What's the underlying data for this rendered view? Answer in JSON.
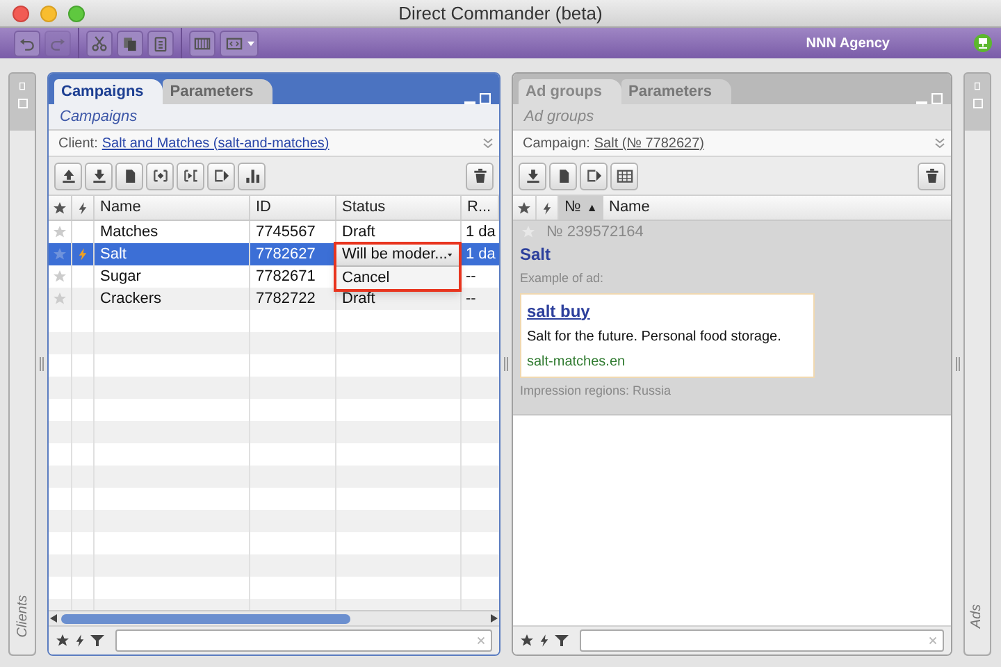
{
  "window": {
    "title": "Direct Commander (beta)"
  },
  "toolbar": {
    "buttons": [
      {
        "kind": "undo",
        "disabled": false
      },
      {
        "kind": "redo",
        "disabled": true
      },
      {
        "kind": "cut",
        "disabled": false
      },
      {
        "kind": "copy",
        "disabled": false
      },
      {
        "kind": "paste",
        "disabled": false
      },
      {
        "kind": "columns",
        "disabled": false
      },
      {
        "kind": "layout",
        "disabled": false
      }
    ],
    "account": "NNN Agency"
  },
  "left_strip": {
    "label": "Clients"
  },
  "campaigns_panel": {
    "tabs": [
      {
        "label": "Campaigns",
        "selected": true
      },
      {
        "label": "Parameters",
        "selected": false
      }
    ],
    "subtitle": "Campaigns",
    "filter_label": "Client:",
    "filter_value": "Salt and Matches (salt-and-matches)",
    "toolbar": [
      {
        "kind": "upload"
      },
      {
        "kind": "download"
      },
      {
        "kind": "document"
      },
      {
        "kind": "swap"
      },
      {
        "kind": "import"
      },
      {
        "kind": "export"
      },
      {
        "kind": "chart"
      }
    ],
    "columns": [
      "Name",
      "ID",
      "Status",
      "R..."
    ],
    "rows": [
      {
        "name": "Matches",
        "id": "7745567",
        "status": "Draft",
        "column_4": "1 da",
        "selected": false,
        "flagged": false
      },
      {
        "name": "Salt",
        "id": "7782627",
        "status_editor": {
          "value": "Will be moder...",
          "options": [
            "Cancel"
          ]
        },
        "column_4": "1 da",
        "selected": true,
        "flagged": true
      },
      {
        "name": "Sugar",
        "id": "7782671",
        "column_4": "--",
        "selected": false,
        "flagged": false
      },
      {
        "name": "Crackers",
        "id": "7782722",
        "status": "Draft",
        "column_4": "--",
        "selected": false,
        "flagged": false
      }
    ]
  },
  "ad_groups_panel": {
    "tabs": [
      {
        "label": "Ad groups",
        "selected": true
      },
      {
        "label": "Parameters",
        "selected": false
      }
    ],
    "subtitle": "Ad groups",
    "filter_label": "Campaign:",
    "filter_value": "Salt (№ 7782627)",
    "toolbar": [
      {
        "kind": "download"
      },
      {
        "kind": "document"
      },
      {
        "kind": "export"
      },
      {
        "kind": "table"
      }
    ],
    "columns": [
      {
        "label": "№",
        "sort_arrow": "▲"
      },
      {
        "label": "Name"
      }
    ],
    "groups": [
      {
        "number": "№ 239572164",
        "name": "Salt",
        "example_label": "Example of ad:",
        "ad": {
          "title": "salt buy",
          "text": "Salt for the future. Personal food storage.",
          "url": "salt-matches.en"
        },
        "regions": "Impression regions: Russia"
      }
    ]
  },
  "right_strip": {
    "label": "Ads"
  }
}
